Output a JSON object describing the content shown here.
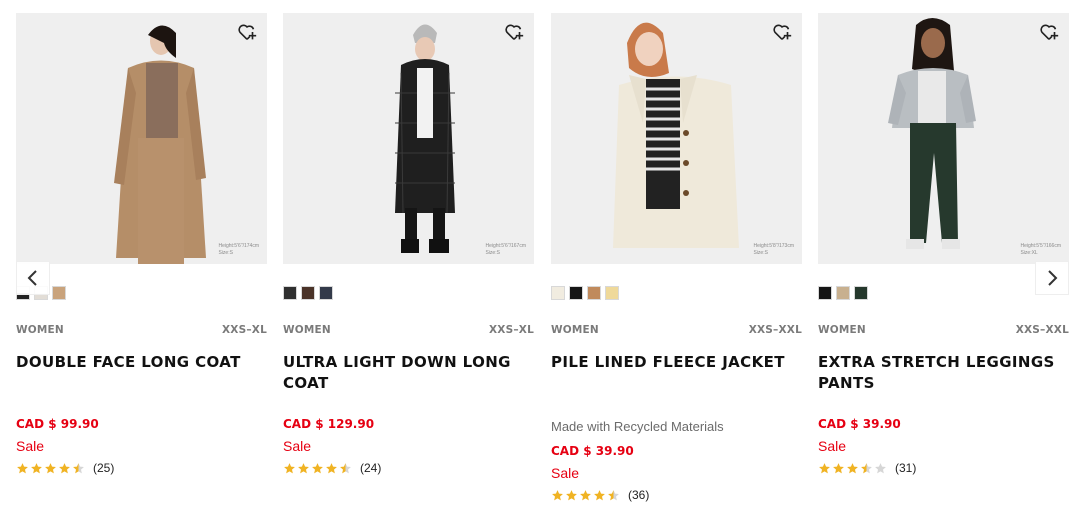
{
  "products": [
    {
      "category": "WOMEN",
      "sizes": "XXS–XL",
      "name": "DOUBLE FACE LONG COAT",
      "note": "",
      "price": "CAD $ 99.90",
      "sale": "Sale",
      "rating": 4.5,
      "review_count": "(25)",
      "size_note_1": "Height:5'6\"/174cm",
      "size_note_2": "Size:S",
      "swatches": [
        "#4a4a4a",
        "#e8e6e2",
        "#c9a37c"
      ],
      "coat_color": "#b58e68"
    },
    {
      "category": "WOMEN",
      "sizes": "XXS–XL",
      "name": "ULTRA LIGHT DOWN LONG COAT",
      "note": "",
      "price": "CAD $ 129.90",
      "sale": "Sale",
      "rating": 4.5,
      "review_count": "(24)",
      "size_note_1": "Height:5'6\"/167cm",
      "size_note_2": "Size:S",
      "swatches": [
        "#2f2f2f",
        "#4a3328",
        "#333a4a"
      ],
      "coat_color": "#1f1f1f"
    },
    {
      "category": "WOMEN",
      "sizes": "XXS–XXL",
      "name": "PILE LINED FLEECE JACKET",
      "note": "Made with Recycled Materials",
      "price": "CAD $ 39.90",
      "sale": "Sale",
      "rating": 4.5,
      "review_count": "(36)",
      "size_note_1": "Height:5'8\"/173cm",
      "size_note_2": "Size:S",
      "swatches": [
        "#f1ece0",
        "#161616",
        "#c08a5c",
        "#efd99a"
      ],
      "coat_color": "#efe9da"
    },
    {
      "category": "WOMEN",
      "sizes": "XXS–XXL",
      "name": "EXTRA STRETCH LEGGINGS PANTS",
      "note": "",
      "price": "CAD $ 39.90",
      "sale": "Sale",
      "rating": 3.5,
      "review_count": "(31)",
      "size_note_1": "Height:5'5\"/166cm",
      "size_note_2": "Size:XL",
      "swatches": [
        "#151515",
        "#c8b08f",
        "#25382c"
      ],
      "coat_color": "#b9bec2"
    }
  ],
  "icons": {
    "wishlist": "heart-plus-icon",
    "prev": "chevron-left-icon",
    "next": "chevron-right-icon",
    "star": "star-icon"
  },
  "colors": {
    "price_red": "#e60012",
    "star_gold": "#f0b323",
    "star_empty": "#d6d6d6"
  }
}
